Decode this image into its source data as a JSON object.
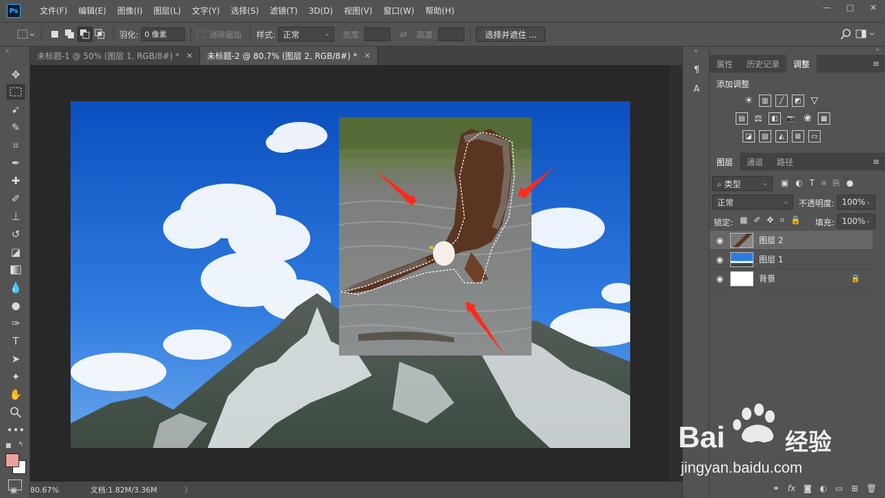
{
  "app": {
    "logo": "Ps"
  },
  "menu": [
    "文件(F)",
    "编辑(E)",
    "图像(I)",
    "图层(L)",
    "文字(Y)",
    "选择(S)",
    "滤镜(T)",
    "3D(D)",
    "视图(V)",
    "窗口(W)",
    "帮助(H)"
  ],
  "window_controls": {
    "minimize": "—",
    "restore": "□",
    "close": "✕"
  },
  "options": {
    "feather_label": "羽化:",
    "feather_value": "0 像素",
    "antialias_label": "消除锯齿",
    "style_label": "样式:",
    "style_value": "正常",
    "width_label": "宽度:",
    "height_label": "高度:",
    "select_mask_button": "选择并遮住 ..."
  },
  "tabs": [
    {
      "label": "未标题-1 @ 50% (图层 1, RGB/8#) *",
      "close": "✕"
    },
    {
      "label": "未标题-2 @ 80.7% (图层 2, RGB/8#) *",
      "close": "✕"
    }
  ],
  "status": {
    "zoom": "80.67%",
    "doc": "文档:1.82M/3.36M",
    "arrow": "〉"
  },
  "panels": {
    "top_tabs": [
      "属性",
      "历史记录",
      "调整"
    ],
    "adjust_title": "添加调整",
    "layers_tabs": [
      "图层",
      "通道",
      "路径"
    ],
    "filter_kind": "类型",
    "blend_mode": "正常",
    "opacity_label": "不透明度:",
    "opacity_value": "100%",
    "lock_label": "锁定:",
    "fill_label": "填充:",
    "fill_value": "100%"
  },
  "layers": [
    {
      "name": "图层 2",
      "selected": true
    },
    {
      "name": "图层 1",
      "selected": false
    },
    {
      "name": "背景",
      "selected": false,
      "locked": true
    }
  ],
  "colors": {
    "foreground": "#e8a49c",
    "background": "#ffffff",
    "accent": "#31a8ff"
  },
  "watermark": {
    "brand": "Bai",
    "brand2": "经验",
    "url": "jingyan.baidu.com"
  }
}
